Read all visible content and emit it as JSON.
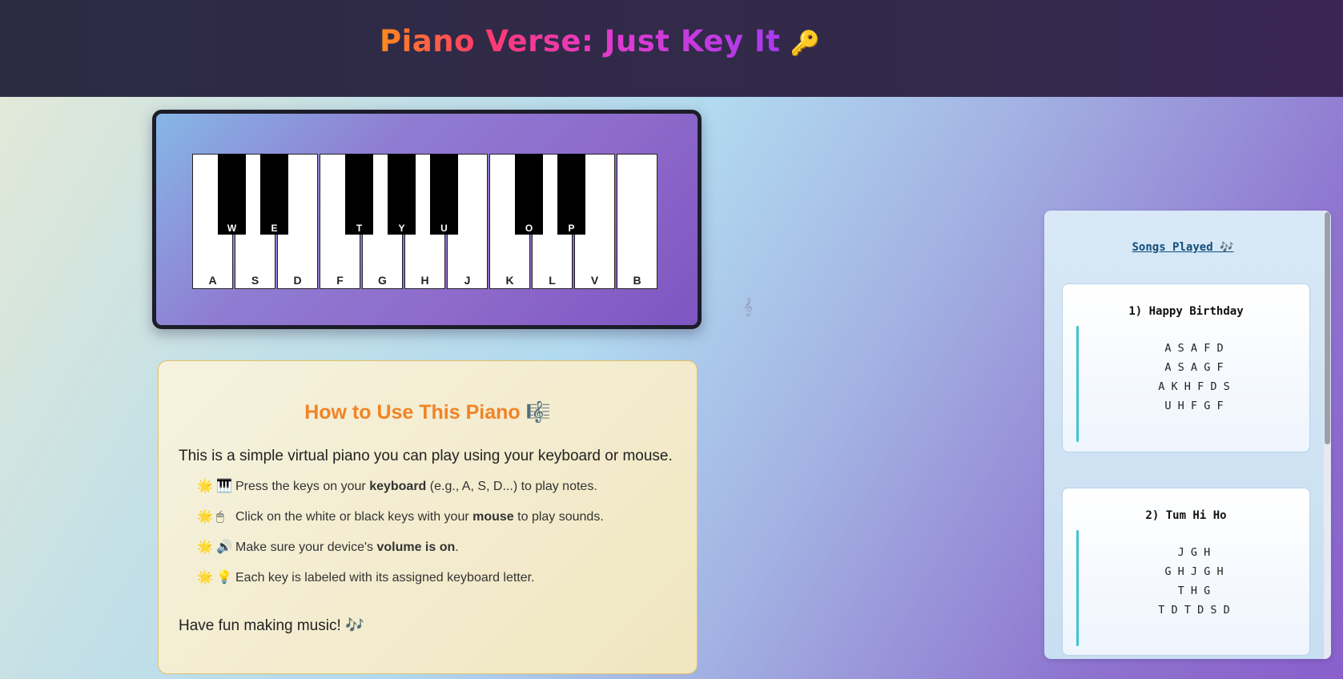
{
  "header": {
    "title": "Piano Verse: Just Key It",
    "title_icon": "🔑"
  },
  "piano": {
    "white_keys": [
      "A",
      "S",
      "D",
      "F",
      "G",
      "H",
      "J",
      "K",
      "L",
      "V",
      "B"
    ],
    "black_keys": [
      "W",
      "E",
      "T",
      "Y",
      "U",
      "O",
      "P"
    ]
  },
  "howto": {
    "heading": "How to Use This Piano",
    "heading_icon": "🎼",
    "intro": "This is a simple virtual piano you can play using your keyboard or mouse.",
    "items": [
      {
        "bullet": "🌟",
        "icon": "🎹",
        "pre": "Press the keys on your ",
        "bold": "keyboard",
        "post": " (e.g., A, S, D...) to play notes."
      },
      {
        "bullet": "🌟",
        "icon": "🖱",
        "pre": "Click on the white or black keys with your ",
        "bold": "mouse",
        "post": " to play sounds."
      },
      {
        "bullet": "🌟",
        "icon": "🔊",
        "pre": "Make sure your device's ",
        "bold": "volume is on",
        "post": "."
      },
      {
        "bullet": "🌟",
        "icon": "💡",
        "pre": "Each key is labeled with its assigned keyboard letter.",
        "bold": "",
        "post": ""
      }
    ],
    "outro": "Have fun making music!",
    "outro_icon": "🎶"
  },
  "decor": {
    "note1": "𝄞",
    "note2": "🎼"
  },
  "songs": {
    "title": "Songs Played 🎶",
    "list": [
      {
        "name": "1) Happy Birthday",
        "lines": [
          "A S A F D",
          "A S A G F",
          "A K H F D S",
          "U H F G F"
        ]
      },
      {
        "name": "2) Tum Hi Ho",
        "lines": [
          "J G H",
          "G H J G H",
          "T H G",
          "T D T D S D"
        ]
      }
    ]
  }
}
